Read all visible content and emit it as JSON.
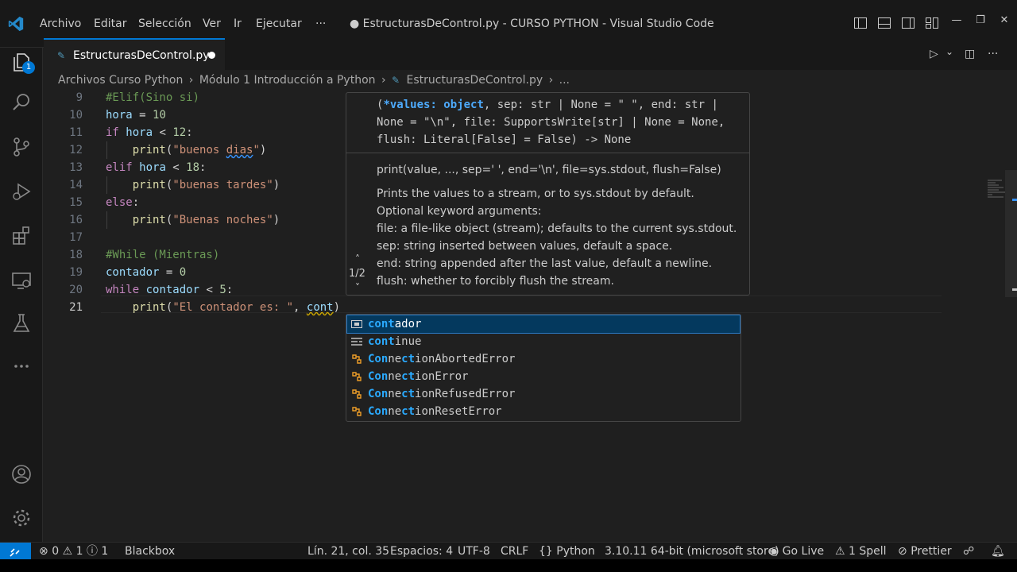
{
  "menu": [
    "Archivo",
    "Editar",
    "Selección",
    "Ver",
    "Ir",
    "Ejecutar",
    "···"
  ],
  "window_title": "● EstructurasDeControl.py - CURSO PYTHON - Visual Studio Code",
  "window_controls": {
    "minimize": "—",
    "restore": "❐",
    "close": "✕"
  },
  "activity": {
    "explorer_badge": "1"
  },
  "tab": {
    "icon": "✎",
    "label": "EstructurasDeControl.py"
  },
  "editor_actions": {
    "run": "▷",
    "run_menu": "⌄",
    "split": "◫",
    "more": "···"
  },
  "breadcrumb": {
    "items": [
      "Archivos Curso Python",
      "Módulo 1 Introducción a Python",
      "EstructurasDeControl.py",
      "..."
    ],
    "separator": "›",
    "file_icon": "✎"
  },
  "code": {
    "line_numbers": [
      "9",
      "10",
      "11",
      "12",
      "13",
      "14",
      "15",
      "16",
      "17",
      "18",
      "19",
      "20",
      "21"
    ],
    "lines": [
      [
        {
          "t": "#Elif(Sino si)",
          "c": "cmt"
        }
      ],
      [
        {
          "t": "hora",
          "c": "var"
        },
        {
          "t": " = ",
          "c": "op"
        },
        {
          "t": "10",
          "c": "num"
        }
      ],
      [
        {
          "t": "if",
          "c": "kw"
        },
        {
          "t": " ",
          "c": "op"
        },
        {
          "t": "hora",
          "c": "var"
        },
        {
          "t": " < ",
          "c": "op"
        },
        {
          "t": "12",
          "c": "num"
        },
        {
          "t": ":",
          "c": "op"
        }
      ],
      [
        {
          "t": "    ",
          "c": "op"
        },
        {
          "t": "print",
          "c": "fn"
        },
        {
          "t": "(",
          "c": "op"
        },
        {
          "t": "\"buenos ",
          "c": "str"
        },
        {
          "t": "dias",
          "c": "str squig"
        },
        {
          "t": "\"",
          "c": "str"
        },
        {
          "t": ")",
          "c": "op"
        }
      ],
      [
        {
          "t": "elif",
          "c": "kw"
        },
        {
          "t": " ",
          "c": "op"
        },
        {
          "t": "hora",
          "c": "var"
        },
        {
          "t": " < ",
          "c": "op"
        },
        {
          "t": "18",
          "c": "num"
        },
        {
          "t": ":",
          "c": "op"
        }
      ],
      [
        {
          "t": "    ",
          "c": "op"
        },
        {
          "t": "print",
          "c": "fn"
        },
        {
          "t": "(",
          "c": "op"
        },
        {
          "t": "\"buenas tardes\"",
          "c": "str"
        },
        {
          "t": ")",
          "c": "op"
        }
      ],
      [
        {
          "t": "else",
          "c": "kw"
        },
        {
          "t": ":",
          "c": "op"
        }
      ],
      [
        {
          "t": "    ",
          "c": "op"
        },
        {
          "t": "print",
          "c": "fn"
        },
        {
          "t": "(",
          "c": "op"
        },
        {
          "t": "\"Buenas noches\"",
          "c": "str"
        },
        {
          "t": ")",
          "c": "op"
        }
      ],
      [],
      [
        {
          "t": "#While (Mientras)",
          "c": "cmt"
        }
      ],
      [
        {
          "t": "contador",
          "c": "var"
        },
        {
          "t": " = ",
          "c": "op"
        },
        {
          "t": "0",
          "c": "num"
        }
      ],
      [
        {
          "t": "while",
          "c": "kw"
        },
        {
          "t": " ",
          "c": "op"
        },
        {
          "t": "contador",
          "c": "var"
        },
        {
          "t": " < ",
          "c": "op"
        },
        {
          "t": "5",
          "c": "num"
        },
        {
          "t": ":",
          "c": "op"
        }
      ],
      [
        {
          "t": "    ",
          "c": "op"
        },
        {
          "t": "print",
          "c": "fn"
        },
        {
          "t": "(",
          "c": "op"
        },
        {
          "t": "\"El contador es: \"",
          "c": "str"
        },
        {
          "t": ", ",
          "c": "op"
        },
        {
          "t": "cont",
          "c": "var squig-y"
        },
        {
          "t": ")",
          "c": "op"
        }
      ]
    ]
  },
  "param_hint": {
    "signature_bold": "*values: object",
    "signature_pre": "(",
    "signature_rest": ", sep: str | None = \" \", end: str | None = \"\\n\", file: SupportsWrite[str] | None = None, flush: Literal[False] = False) -> None",
    "doc_signature": "print(value, ..., sep=' ', end='\\n', file=sys.stdout, flush=False)",
    "doc_lines": [
      "Prints the values to a stream, or to sys.stdout by default.",
      "Optional keyword arguments:",
      "file: a file-like object (stream); defaults to the current sys.stdout.",
      "sep: string inserted between values, default a space.",
      "end: string appended after the last value, default a newline.",
      "flush: whether to forcibly flush the stream."
    ],
    "counter": "1/2",
    "up": "˄",
    "down": "˅"
  },
  "suggestions": [
    {
      "icon": "variable-icon",
      "parts": [
        [
          "cont",
          true
        ],
        [
          "ador",
          false
        ]
      ]
    },
    {
      "icon": "keyword-icon",
      "parts": [
        [
          "cont",
          true
        ],
        [
          "inue",
          false
        ]
      ]
    },
    {
      "icon": "class-icon",
      "parts": [
        [
          "Con",
          true
        ],
        [
          "ne",
          false
        ],
        [
          "c",
          true
        ],
        [
          "t",
          true
        ],
        [
          "ionAbortedError",
          false
        ]
      ]
    },
    {
      "icon": "class-icon",
      "parts": [
        [
          "Con",
          true
        ],
        [
          "ne",
          false
        ],
        [
          "c",
          true
        ],
        [
          "t",
          true
        ],
        [
          "ionError",
          false
        ]
      ]
    },
    {
      "icon": "class-icon",
      "parts": [
        [
          "Con",
          true
        ],
        [
          "ne",
          false
        ],
        [
          "c",
          true
        ],
        [
          "t",
          true
        ],
        [
          "ionRefusedError",
          false
        ]
      ]
    },
    {
      "icon": "class-icon",
      "parts": [
        [
          "Con",
          true
        ],
        [
          "ne",
          false
        ],
        [
          "c",
          true
        ],
        [
          "t",
          true
        ],
        [
          "ionResetError",
          false
        ]
      ]
    }
  ],
  "status": {
    "errors": "0",
    "warnings": "1",
    "infos": "1",
    "blackbox": "Blackbox",
    "position": "Lín. 21, col. 35",
    "spaces": "Espacios: 4",
    "encoding": "UTF-8",
    "eol": "CRLF",
    "language": "Python",
    "interpreter": "3.10.11 64-bit (microsoft store)",
    "golive": "Go Live",
    "spell": "1 Spell",
    "prettier": "Prettier"
  },
  "colors": {
    "accent": "#0078d4",
    "editor_bg": "#1f1f1f",
    "chrome_bg": "#181818"
  }
}
